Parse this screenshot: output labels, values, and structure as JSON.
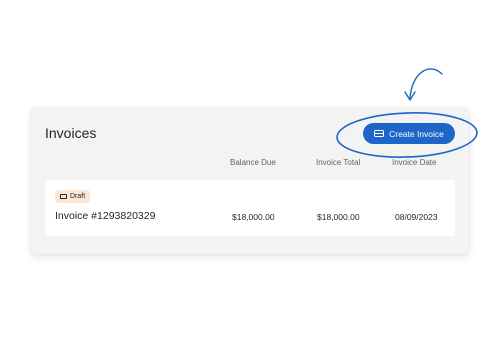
{
  "invoices": {
    "title": "Invoices",
    "create_button_label": "Create Invoice",
    "columns": [
      "Balance Due",
      "Invoice Total",
      "Invoice Date"
    ],
    "rows": [
      {
        "status": "Draft",
        "name": "Invoice #1293820329",
        "balance_due": "$18,000.00",
        "invoice_total": "$18,000.00",
        "invoice_date": "08/09/2023"
      }
    ]
  },
  "colors": {
    "accent": "#1d66c7",
    "draft_badge": "#fce7d4",
    "card_bg": "#f3f3f3"
  },
  "icons": {
    "create_button": "credit-card-icon",
    "draft_badge": "credit-card-icon",
    "annotation": "curved-arrow-icon"
  }
}
